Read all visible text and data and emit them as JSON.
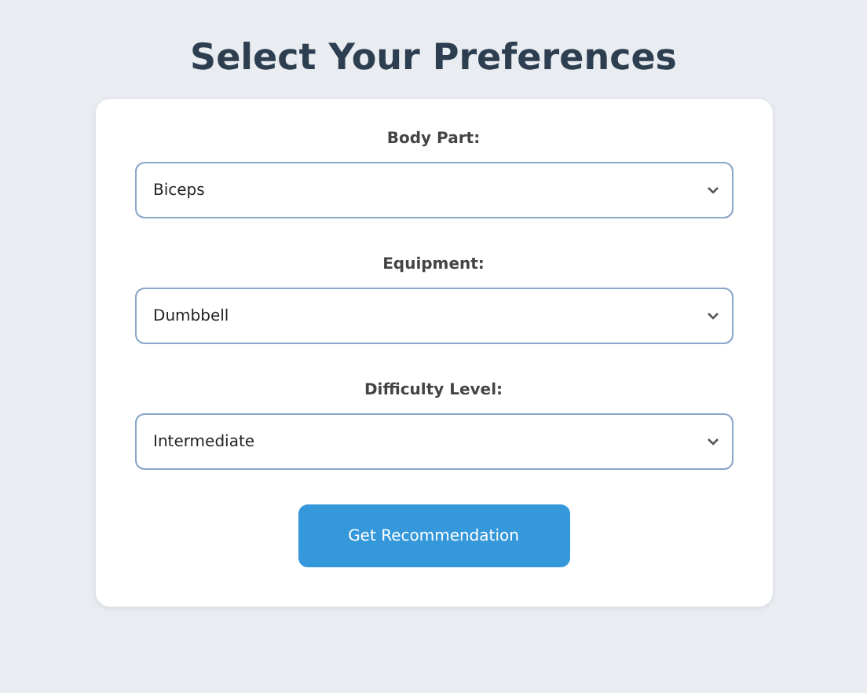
{
  "title": "Select Your Preferences",
  "fields": [
    {
      "label": "Body Part:",
      "value": "Biceps"
    },
    {
      "label": "Equipment:",
      "value": "Dumbbell"
    },
    {
      "label": "Difficulty Level:",
      "value": "Intermediate"
    }
  ],
  "button": "Get Recommendation"
}
